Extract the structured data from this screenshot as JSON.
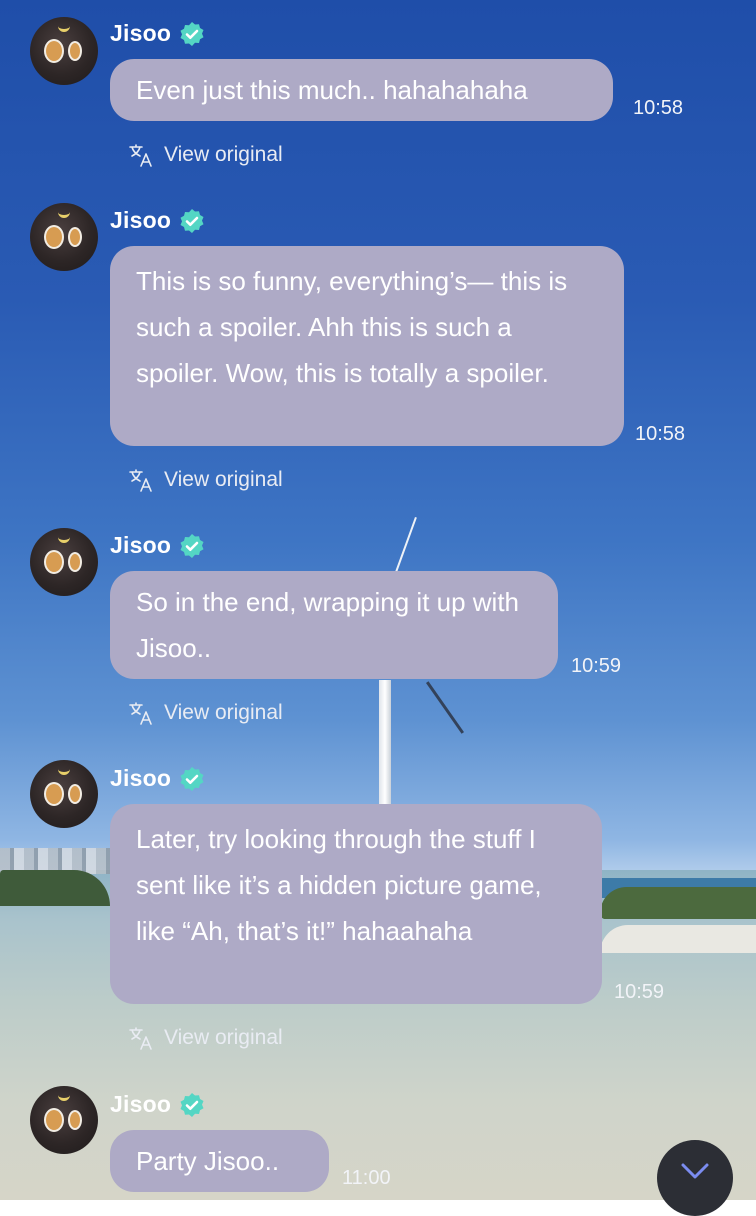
{
  "chat": {
    "messages": [
      {
        "sender": "Jisoo",
        "verified": true,
        "text": "Even just this much.. hahahahaha",
        "time": "10:58",
        "translate_link": "View original"
      },
      {
        "sender": "Jisoo",
        "verified": true,
        "text": "This is so funny, everything’s— this is such a spoiler. Ahh this is such a spoiler. Wow, this is totally a spoiler.",
        "time": "10:58",
        "translate_link": "View original"
      },
      {
        "sender": "Jisoo",
        "verified": true,
        "text": "So in the end, wrapping it up with Jisoo..",
        "time": "10:59",
        "translate_link": "View original"
      },
      {
        "sender": "Jisoo",
        "verified": true,
        "text": "Later, try looking through the stuff I sent like it’s a hidden picture game, like “Ah, that’s it!” hahaahaha",
        "time": "10:59",
        "translate_link": "View original"
      },
      {
        "sender": "Jisoo",
        "verified": true,
        "text": "Party Jisoo..",
        "time": "11:00"
      }
    ]
  },
  "icons": {
    "verified": "verified-badge-icon",
    "translate": "translate-icon",
    "scroll_down": "chevron-down-icon"
  },
  "colors": {
    "bubble": "#aeaac6",
    "verified_badge": "#54d6c4",
    "scroll_button": "#2c2e35",
    "scroll_chevron": "#7b8cf0"
  }
}
